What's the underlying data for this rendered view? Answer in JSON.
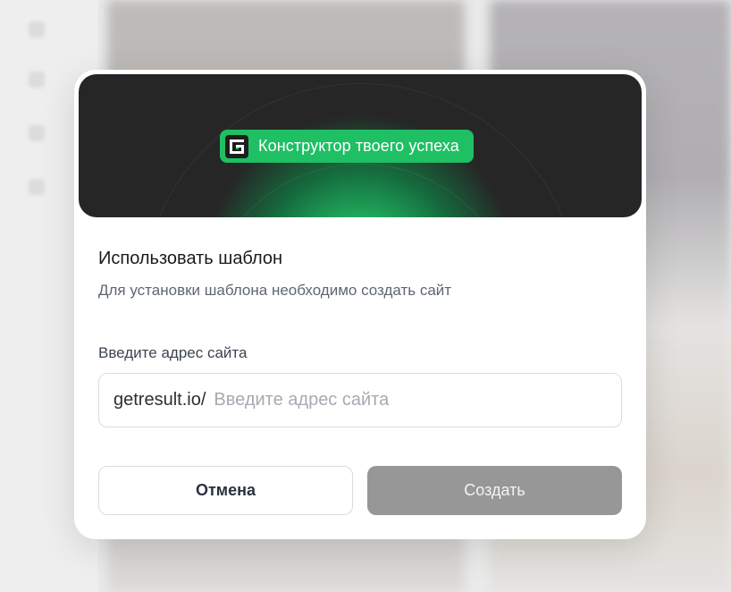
{
  "hero": {
    "badge_text": "Конструктор твоего успеха",
    "logo_icon": "getresult-logo-icon",
    "accent_color": "#1fbf64"
  },
  "dialog": {
    "title": "Использовать шаблон",
    "subtitle": "Для установки шаблона необходимо создать сайт",
    "field_label": "Введите адрес сайта",
    "address_prefix": "getresult.io/",
    "address_value": "",
    "address_placeholder": "Введите адрес сайта",
    "cancel_label": "Отмена",
    "create_label": "Создать",
    "create_disabled_color": "#979797"
  }
}
